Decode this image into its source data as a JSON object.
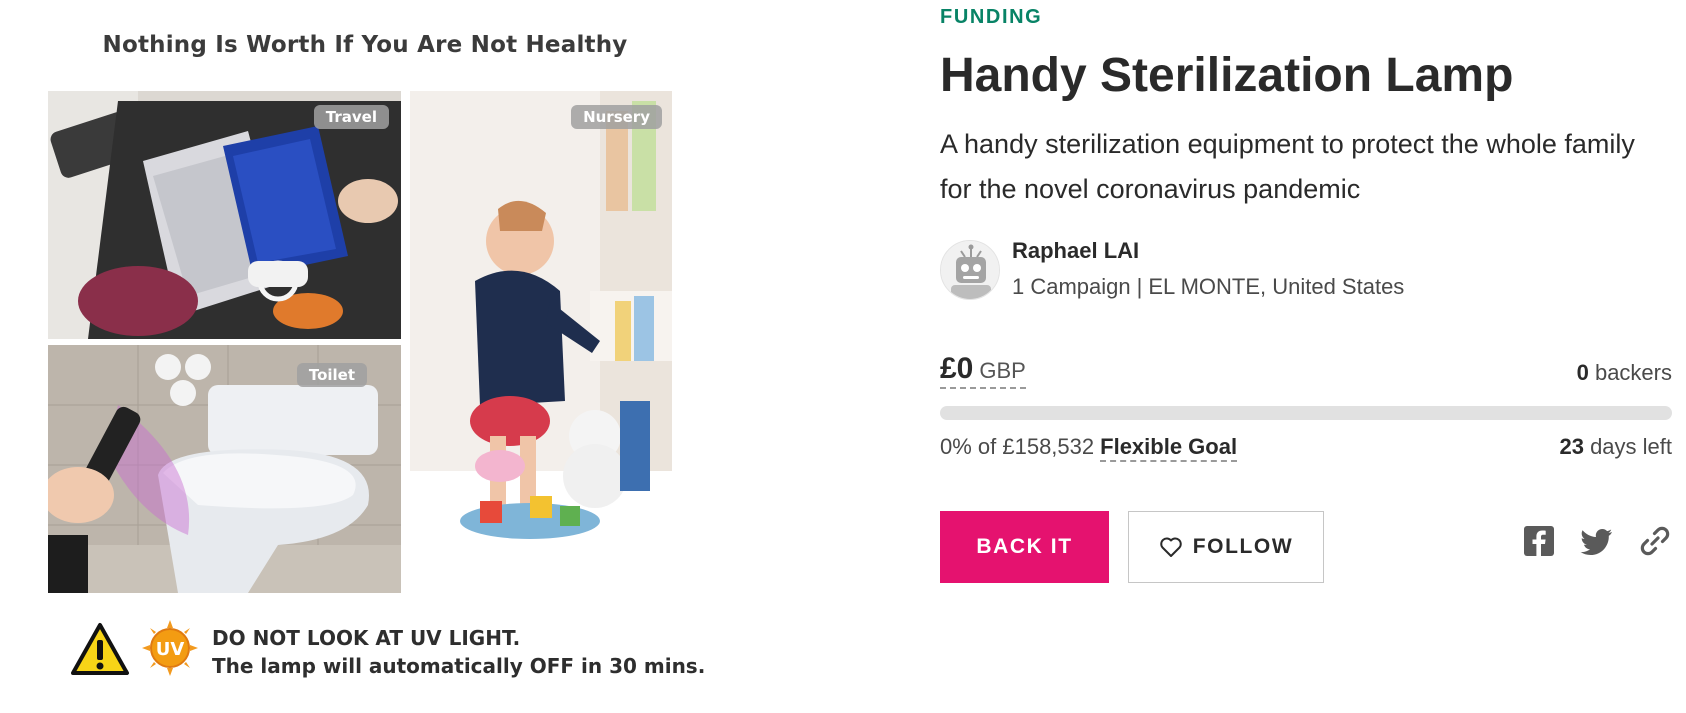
{
  "hero": {
    "headline": "Nothing Is Worth If You Are Not Healthy",
    "tags": {
      "travel": "Travel",
      "nursery": "Nursery",
      "toilet": "Toilet"
    },
    "uv_badge_text": "UV",
    "warning_line1": "DO NOT LOOK AT UV LIGHT.",
    "warning_line2": "The lamp will automatically OFF in 30 mins."
  },
  "campaign": {
    "category": "FUNDING",
    "title": "Handy Sterilization Lamp",
    "subtitle": "A handy sterilization equipment to protect the whole family for the novel coronavirus pandemic"
  },
  "owner": {
    "name": "Raphael LAI",
    "campaigns": "1 Campaign",
    "separator": "|",
    "location": "EL MONTE, United States"
  },
  "funding": {
    "amount": "£0",
    "currency": "GBP",
    "backers_count": "0",
    "backers_label": "backers",
    "percent_text": "0% of £158,532",
    "goal_type": "Flexible Goal",
    "days_count": "23",
    "days_label": "days left",
    "progress_fraction": 0
  },
  "actions": {
    "back_label": "BACK IT",
    "follow_label": "FOLLOW"
  },
  "share": {
    "icons": [
      "facebook-icon",
      "twitter-icon",
      "link-icon"
    ]
  },
  "colors": {
    "accent": "#e5126f",
    "category_green": "#088366",
    "progress_track": "#e1e1e1"
  }
}
